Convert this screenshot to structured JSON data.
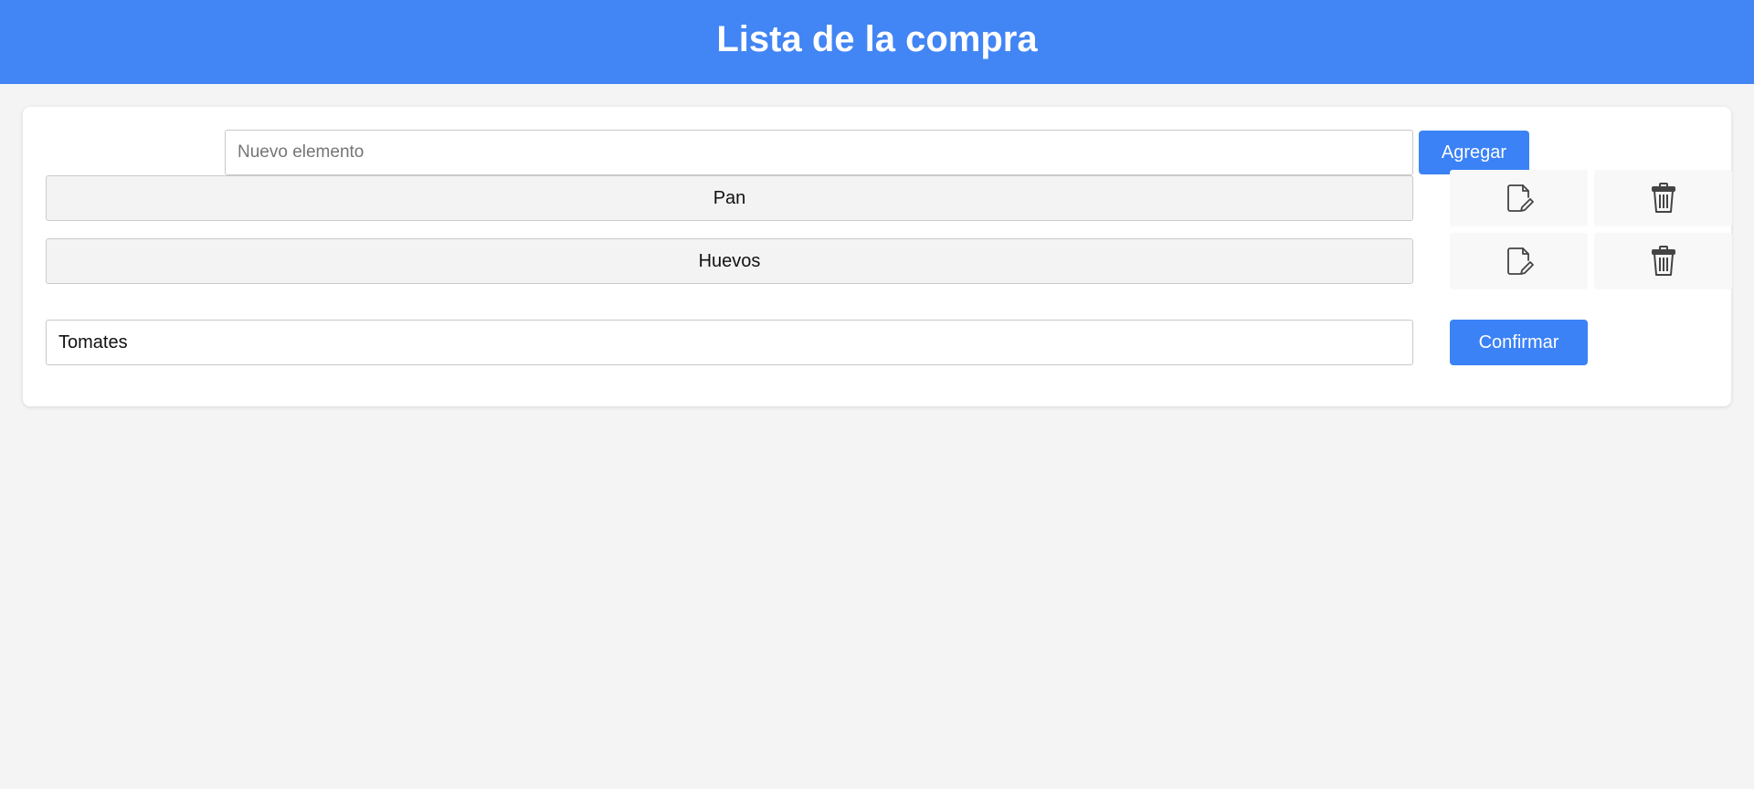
{
  "header": {
    "title": "Lista de la compra"
  },
  "new_item": {
    "placeholder": "Nuevo elemento",
    "value": "",
    "add_label": "Agregar"
  },
  "items": [
    {
      "label": "Pan",
      "edit_icon": "edit-document-icon",
      "delete_icon": "trash-icon"
    },
    {
      "label": "Huevos",
      "edit_icon": "edit-document-icon",
      "delete_icon": "trash-icon"
    }
  ],
  "editing": {
    "value": "Tomates",
    "confirm_label": "Confirmar"
  },
  "colors": {
    "header_bg": "#4285f4",
    "button_bg": "#3b82f6",
    "page_bg": "#f4f4f4"
  }
}
